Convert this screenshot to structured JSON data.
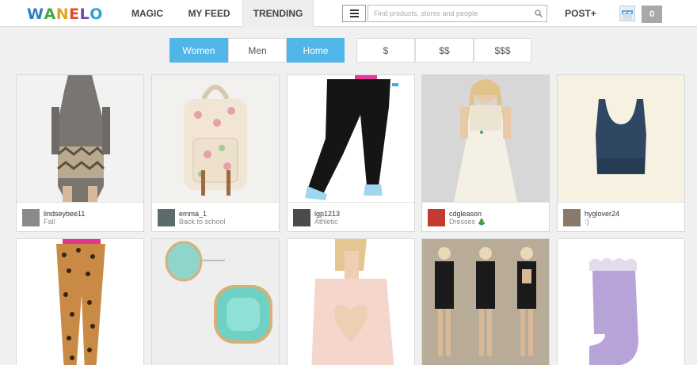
{
  "header": {
    "logo_letters": [
      "W",
      "A",
      "N",
      "E",
      "L",
      "O"
    ],
    "logo_colors": [
      "#2f80c2",
      "#3ea845",
      "#e3a51c",
      "#e04a2c",
      "#6a49a8",
      "#2fa0d6"
    ],
    "nav": {
      "magic": "MAGIC",
      "my_feed": "MY FEED",
      "trending": "TRENDING"
    },
    "search_placeholder": "Find products, stores and people",
    "post_label": "POST+",
    "notification_count": "0"
  },
  "filters": {
    "categories": [
      {
        "label": "Women",
        "active": true
      },
      {
        "label": "Men",
        "active": false
      },
      {
        "label": "Home",
        "active": true
      }
    ],
    "prices": [
      "$",
      "$$",
      "$$$"
    ],
    "accent_color": "#52b5e8"
  },
  "products": [
    {
      "user": "lindseybee11",
      "list": "Fall",
      "icon": "hooded-sweater-dress"
    },
    {
      "user": "emma_1",
      "list": "Back to school",
      "icon": "floral-backpack"
    },
    {
      "user": "lgp1213",
      "list": "Athletic",
      "icon": "black-leggings"
    },
    {
      "user": "cdgleason",
      "list": "Dresses 🎄",
      "icon": "white-lace-dress"
    },
    {
      "user": "hyglover24",
      "list": ":)",
      "icon": "navy-crop-top"
    },
    {
      "icon": "leopard-leggings"
    },
    {
      "icon": "mint-earrings"
    },
    {
      "icon": "heart-back-top"
    },
    {
      "icon": "cutout-black-dress"
    },
    {
      "icon": "lavender-ruffle-socks"
    }
  ]
}
